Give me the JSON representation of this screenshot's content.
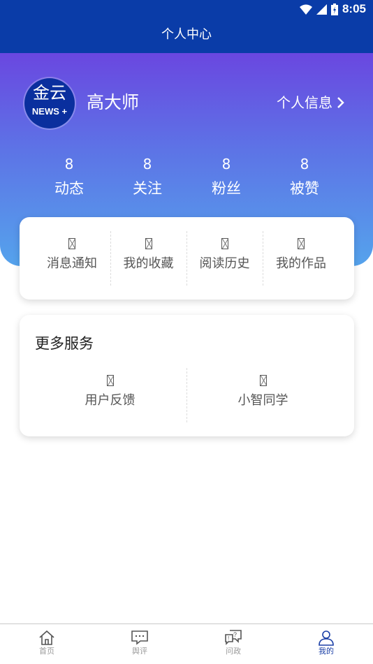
{
  "status_bar": {
    "time": "8:05",
    "icons": [
      "wifi-icon",
      "signal-icon",
      "battery-icon"
    ]
  },
  "header": {
    "title": "个人中心"
  },
  "profile": {
    "avatar_text_top": "金云",
    "avatar_text_bottom": "NEWS +",
    "name": "高大师",
    "info_link": "个人信息"
  },
  "stats": [
    {
      "value": "8",
      "label": "动态"
    },
    {
      "value": "8",
      "label": "关注"
    },
    {
      "value": "8",
      "label": "粉丝"
    },
    {
      "value": "8",
      "label": "被赞"
    }
  ],
  "quick_actions": [
    {
      "icon": "□",
      "label": "消息通知"
    },
    {
      "icon": "□",
      "label": "我的收藏"
    },
    {
      "icon": "□",
      "label": "阅读历史"
    },
    {
      "icon": "□",
      "label": "我的作品"
    }
  ],
  "services": {
    "title": "更多服务",
    "items": [
      {
        "icon": "□",
        "label": "用户反馈"
      },
      {
        "icon": "□",
        "label": "小智同学"
      }
    ]
  },
  "tabbar": {
    "active": 3,
    "items": [
      {
        "label": "首页",
        "icon": "home-icon"
      },
      {
        "label": "舆评",
        "icon": "comment-icon"
      },
      {
        "label": "问政",
        "icon": "question-icon"
      },
      {
        "label": "我的",
        "icon": "user-icon"
      }
    ]
  },
  "colors": {
    "header_bg": "#0a3ca8",
    "gradient_top": "#6a47e0",
    "gradient_bottom": "#55a3ec",
    "active_tab": "#1b3fa6",
    "inactive_tab": "#9a9a9a"
  }
}
